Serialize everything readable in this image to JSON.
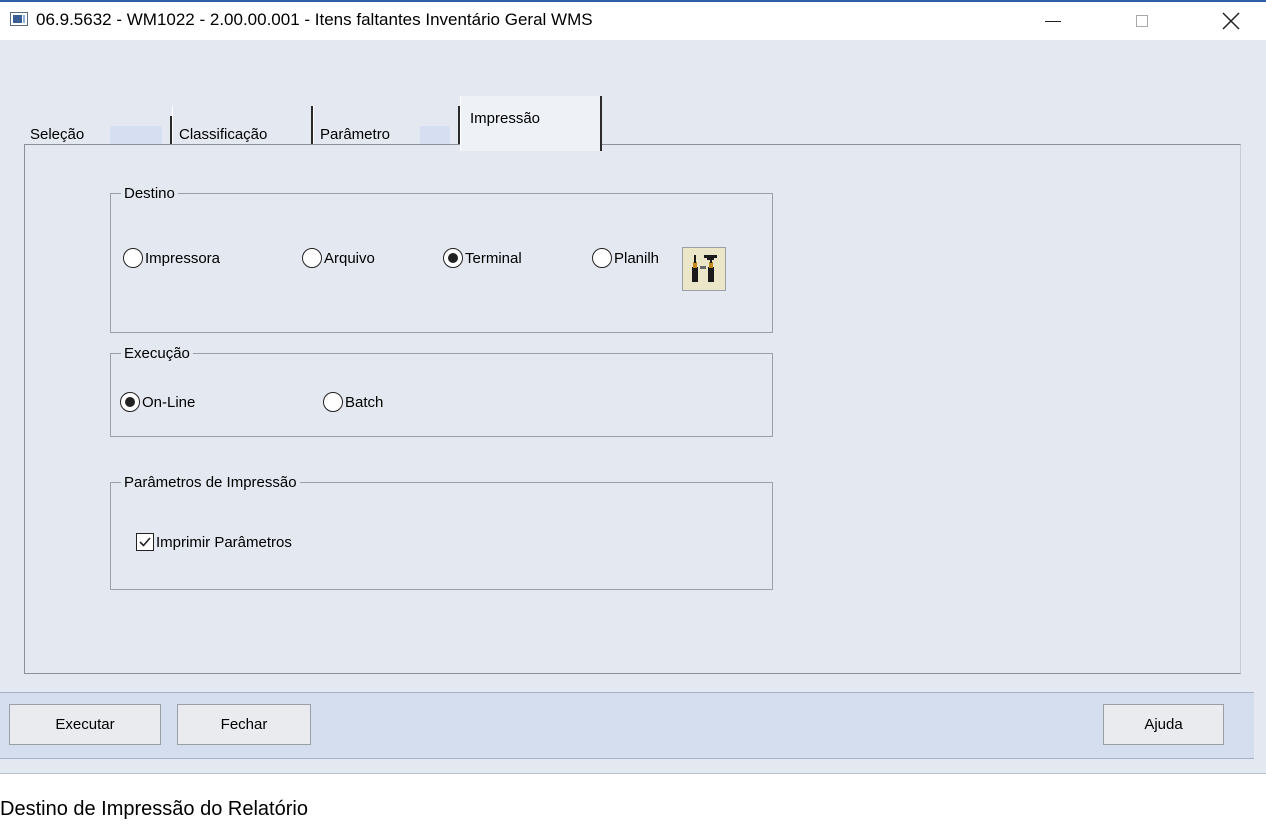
{
  "window": {
    "title": "06.9.5632 - WM1022 - 2.00.00.001 - Itens faltantes Inventário Geral WMS",
    "icons": {
      "app": "app-window-icon",
      "minimize": "minimize-icon",
      "maximize": "maximize-icon",
      "close": "close-icon"
    }
  },
  "tabs": [
    {
      "label": "Seleção",
      "active": false
    },
    {
      "label": "Classificação",
      "active": false
    },
    {
      "label": "Parâmetro",
      "active": false
    },
    {
      "label": "Impressão",
      "active": true
    }
  ],
  "destino": {
    "legend": "Destino",
    "options": [
      {
        "label": "Impressora",
        "checked": false
      },
      {
        "label": "Arquivo",
        "checked": false
      },
      {
        "label": "Terminal",
        "checked": true
      },
      {
        "label": "Planilh",
        "checked": false
      }
    ],
    "config_icon": "tools-config-icon"
  },
  "execucao": {
    "legend": "Execução",
    "options": [
      {
        "label": "On-Line",
        "checked": true
      },
      {
        "label": "Batch",
        "checked": false
      }
    ]
  },
  "parametros": {
    "legend": "Parâmetros de Impressão",
    "imprimir_label": "Imprimir Parâmetros",
    "imprimir_checked": true
  },
  "buttons": {
    "executar": "Executar",
    "fechar": "Fechar",
    "ajuda": "Ajuda"
  },
  "status": {
    "text": "Destino de Impressão do Relatório"
  },
  "colors": {
    "window_bg": "#e4e8f0",
    "button_bar_bg": "#d5deee",
    "tab_label_highlight": "#d6dff2",
    "title_accent": "#2f5fa8"
  }
}
